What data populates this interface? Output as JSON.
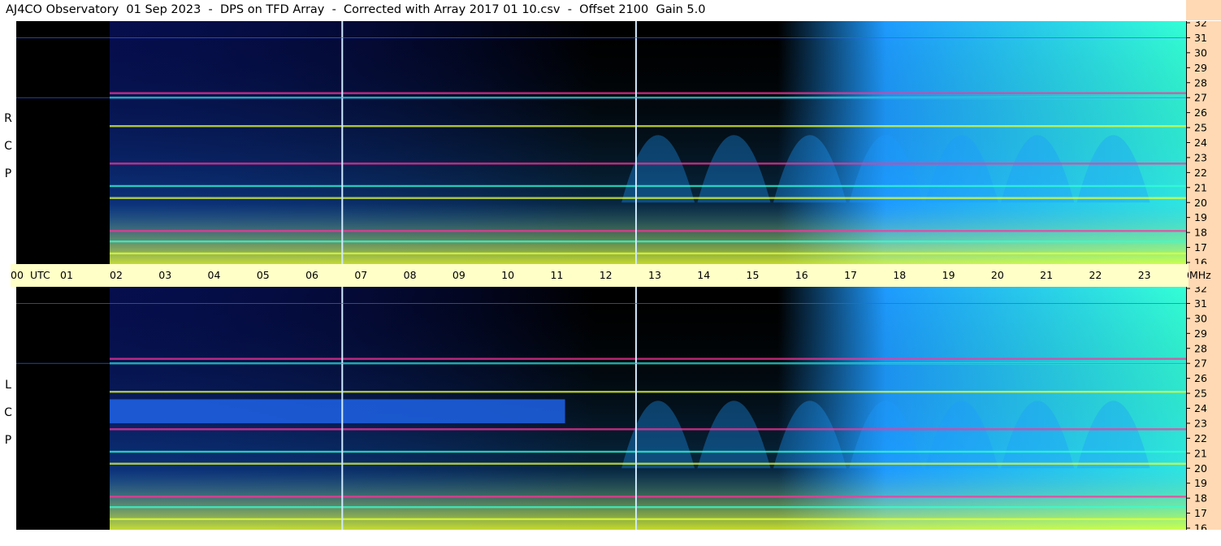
{
  "title": "AJ4CO Observatory  01 Sep 2023  -  DPS on TFD Array  -  Corrected with Array 2017 01 10.csv  -  Offset 2100  Gain 5.0",
  "panels": [
    {
      "polarization_label": [
        "R",
        "C",
        "P"
      ]
    },
    {
      "polarization_label": [
        "L",
        "C",
        "P"
      ]
    }
  ],
  "chart_data": {
    "type": "heatmap",
    "title": "AJ4CO Observatory  01 Sep 2023  -  DPS on TFD Array  -  Corrected with Array 2017 01 10.csv  -  Offset 2100  Gain 5.0",
    "x_axis": {
      "tick_labels": [
        "00",
        "UTC",
        "01",
        "02",
        "03",
        "04",
        "05",
        "06",
        "07",
        "08",
        "09",
        "10",
        "11",
        "12",
        "13",
        "14",
        "15",
        "16",
        "17",
        "18",
        "19",
        "20",
        "21",
        "22",
        "23",
        "00"
      ],
      "hours": [
        0,
        1,
        2,
        3,
        4,
        5,
        6,
        7,
        8,
        9,
        10,
        11,
        12,
        13,
        14,
        15,
        16,
        17,
        18,
        19,
        20,
        21,
        22,
        23,
        24
      ],
      "range": [
        0,
        24
      ]
    },
    "y_axis": {
      "unit_label": "MHz",
      "ticks": [
        16,
        17,
        18,
        19,
        20,
        21,
        22,
        23,
        24,
        25,
        26,
        27,
        28,
        29,
        30,
        31,
        32
      ],
      "range": [
        16,
        32
      ]
    },
    "series": [
      {
        "name": "RCP"
      },
      {
        "name": "LCP"
      }
    ],
    "colors": {
      "background": "#000000",
      "low": "#0a1a8c",
      "mid": "#1e9bff",
      "high": "#33ffd6",
      "peak": "#e6ff33",
      "hot": "#ff3399"
    },
    "no_data_before_hour": 2,
    "marker_lines_hours": [
      6.75,
      12.75
    ],
    "interference_bands_mhz": [
      16.6,
      17.4,
      18.1,
      20.3,
      21.1,
      22.6,
      25.1,
      27.0,
      27.3
    ]
  }
}
